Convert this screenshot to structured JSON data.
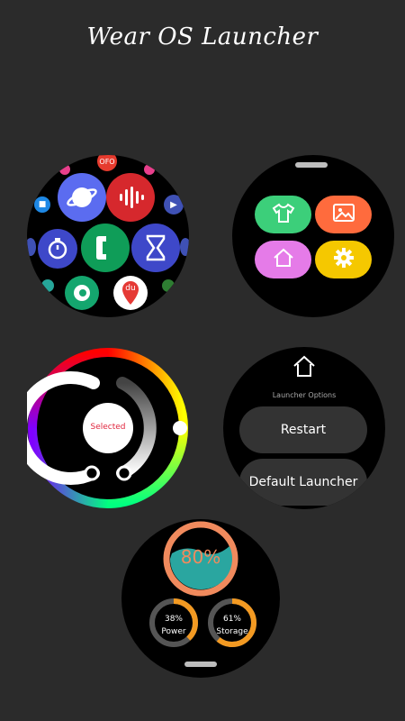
{
  "app_title": "Wear OS Launcher",
  "watch1": {
    "icons": [
      "planet-app-icon",
      "sound-wave-app-icon",
      "phone-app-icon",
      "stopwatch-app-icon",
      "hourglass-app-icon",
      "contact-app-icon",
      "du-map-app-icon",
      "chat-app-icon",
      "play-app-icon",
      "ofo-app-icon"
    ],
    "badge_text": "du",
    "top_label": "OFO"
  },
  "watch2": {
    "tiles": [
      {
        "name": "theme",
        "color": "#3ccf7a",
        "icon": "shirt-icon"
      },
      {
        "name": "wallpaper",
        "color": "#ff6b3d",
        "icon": "picture-icon"
      },
      {
        "name": "home",
        "color": "#e57be8",
        "icon": "home-icon"
      },
      {
        "name": "settings",
        "color": "#f5c800",
        "icon": "gear-icon"
      }
    ]
  },
  "watch3": {
    "center_label": "Selected",
    "accent": "#e0263e"
  },
  "watch4": {
    "header": "Launcher Options",
    "buttons": [
      "Restart",
      "Default Launcher"
    ]
  },
  "watch5": {
    "main_value": "80%",
    "main_percent": 80,
    "power": {
      "value": "38%",
      "label": "Power",
      "percent": 38
    },
    "storage": {
      "value": "61%",
      "label": "Storage",
      "percent": 61
    },
    "ring_color": "#f08a5d",
    "fill_color": "#2aa6a0",
    "small_ring_color": "#f39a22"
  }
}
